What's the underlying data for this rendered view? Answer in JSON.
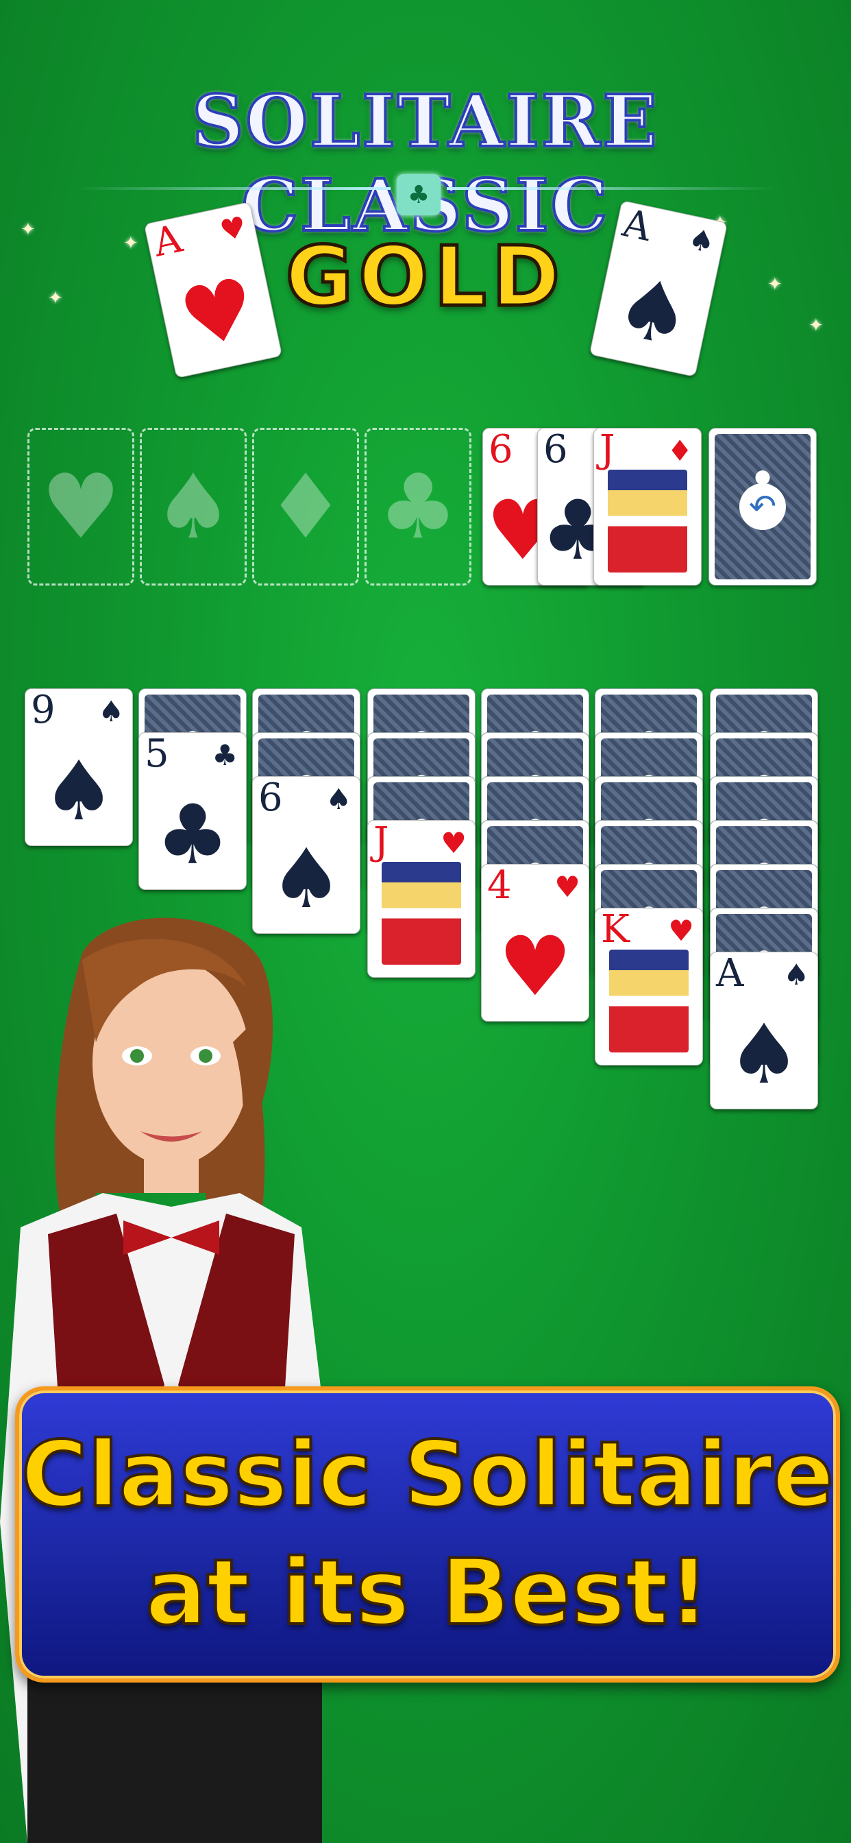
{
  "header": {
    "title": "SOLITAIRE CLASSIC",
    "subtitle": "GOLD"
  },
  "foundations": [
    {
      "suit": "♥"
    },
    {
      "suit": "♠"
    },
    {
      "suit": "♦"
    },
    {
      "suit": "♣"
    }
  ],
  "waste": [
    {
      "rank": "6",
      "suit": "♥",
      "color": "red"
    },
    {
      "rank": "6",
      "suit": "♣",
      "color": "black"
    },
    {
      "rank": "J",
      "suit": "♦",
      "color": "red"
    }
  ],
  "decorative_cards": [
    {
      "rank": "A",
      "suit": "♥"
    },
    {
      "rank": "A",
      "suit": "♠"
    }
  ],
  "tableau": [
    {
      "hidden": 0,
      "rank": "9",
      "suit": "♠"
    },
    {
      "hidden": 1,
      "rank": "5",
      "suit": "♣"
    },
    {
      "hidden": 2,
      "rank": "6",
      "suit": "♠"
    },
    {
      "hidden": 3,
      "rank": "J",
      "suit": "♥"
    },
    {
      "hidden": 4,
      "rank": "4",
      "suit": "♥"
    },
    {
      "hidden": 5,
      "rank": "K",
      "suit": "♥"
    },
    {
      "hidden": 6,
      "rank": "A",
      "suit": "♠"
    }
  ],
  "banner": {
    "line1": "Classic Solitaire",
    "line2": "at its Best!"
  },
  "colors": {
    "felt": "#12a033",
    "banner": "#1c28a6",
    "banner_border": "#f59a1c",
    "gold_text": "#ffd000"
  }
}
